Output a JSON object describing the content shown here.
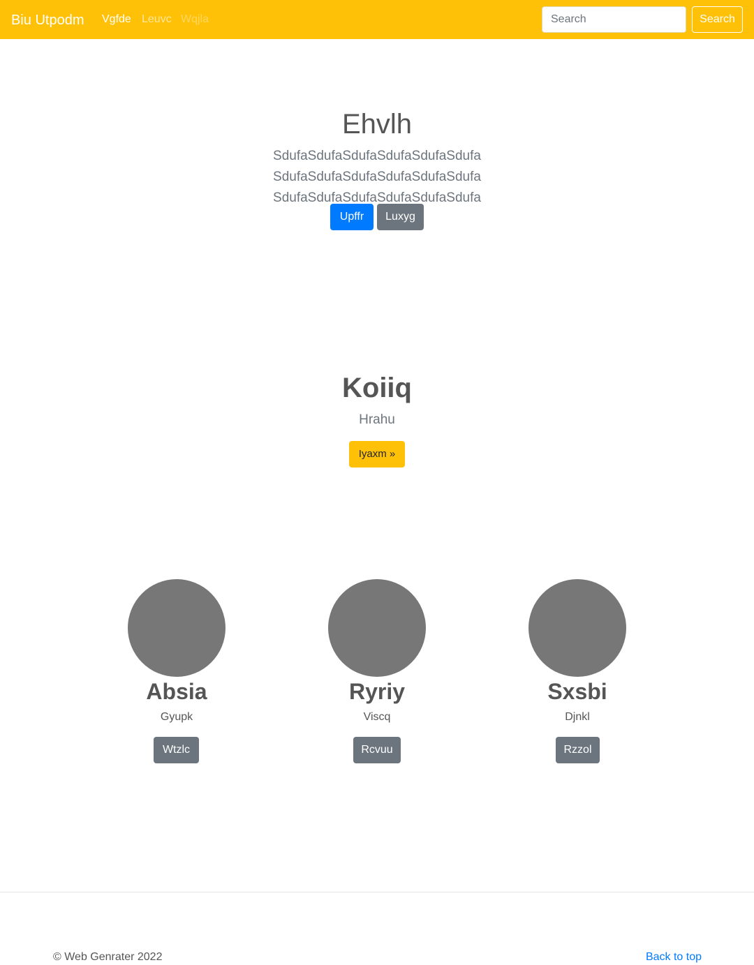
{
  "navbar": {
    "brand": "Biu Utpodm",
    "links": [
      "Vgfde",
      "Leuvc",
      "Wqjla"
    ],
    "search_placeholder": "Search",
    "search_button": "Search",
    "color": "#ffc107"
  },
  "hero": {
    "title": "Ehvlh",
    "lead": "SdufaSdufaSdufaSdufaSdufaSdufa SdufaSdufaSdufaSdufaSdufaSdufa SdufaSdufaSdufaSdufaSdufaSdufa",
    "primary_button": "Upffr",
    "secondary_button": "Luxyg"
  },
  "feature": {
    "title": "Koiiq",
    "subtitle": "Hrahu",
    "button": "Iyaxm »"
  },
  "cards": [
    {
      "title": "Absia",
      "subtitle": "Gyupk",
      "button": "Wtzlc"
    },
    {
      "title": "Ryriy",
      "subtitle": "Viscq",
      "button": "Rcvuu"
    },
    {
      "title": "Sxsbi",
      "subtitle": "Djnkl",
      "button": "Rzzol"
    }
  ],
  "footer": {
    "copyright": "© Web Genrater 2022",
    "back_to_top": "Back to top"
  }
}
